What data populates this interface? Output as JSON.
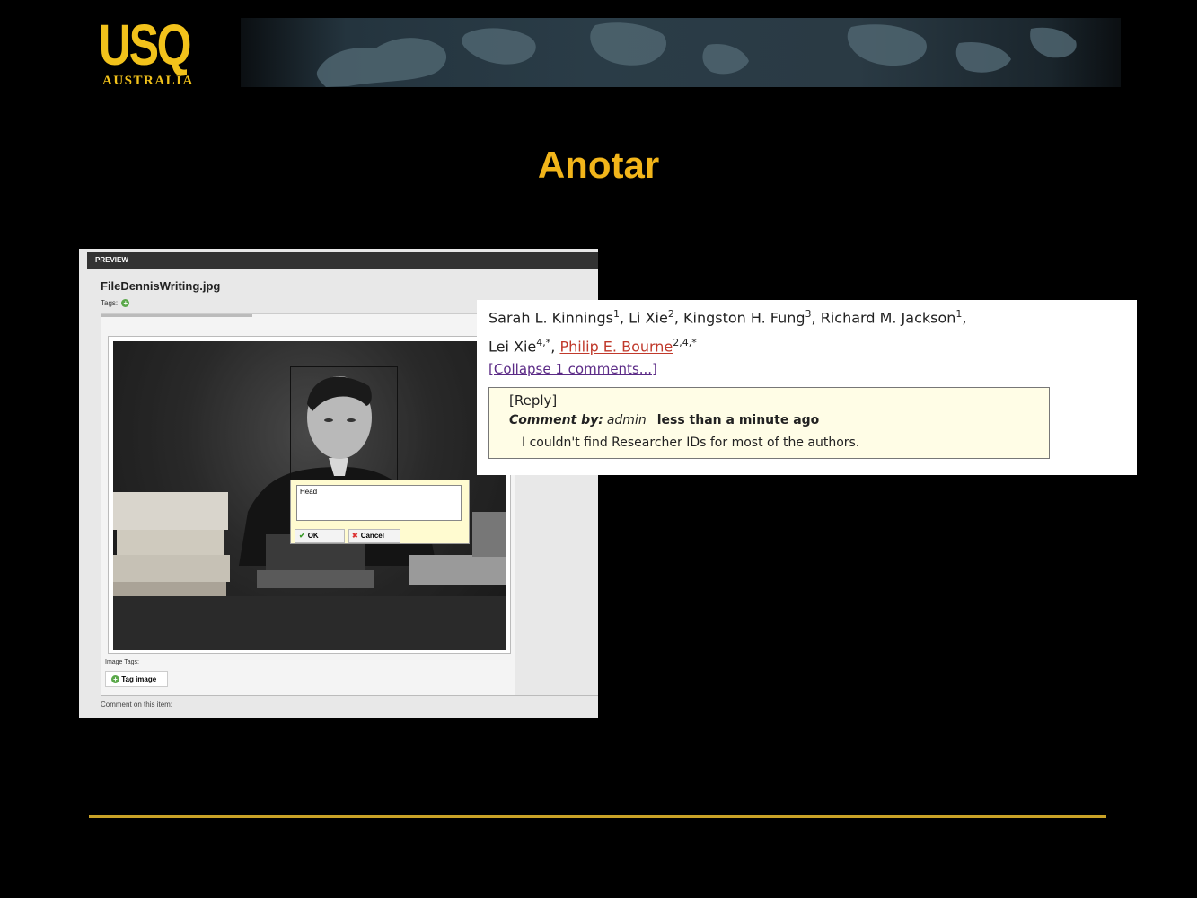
{
  "logo": {
    "main": "USQ",
    "sub": "AUSTRALIA"
  },
  "slide": {
    "title": "Anotar"
  },
  "preview": {
    "header": "PREVIEW",
    "filename": "FileDennisWriting.jpg",
    "tags_label": "Tags:",
    "tag_input_value": "Head",
    "ok_label": "OK",
    "cancel_label": "Cancel",
    "image_tags_label": "Image Tags:",
    "tag_image_label": "Tag image",
    "comment_label": "Comment on this item:"
  },
  "paper": {
    "authors": [
      {
        "name": "Sarah L. Kinnings",
        "sup": "1"
      },
      {
        "name": "Li Xie",
        "sup": "2"
      },
      {
        "name": "Kingston H. Fung",
        "sup": "3"
      },
      {
        "name": "Richard M. Jackson",
        "sup": "1"
      },
      {
        "name": "Lei Xie",
        "sup": "4,*"
      },
      {
        "name": "Philip E. Bourne",
        "sup": "2,4,*"
      }
    ],
    "collapse_link": "[Collapse 1 comments...]",
    "reply_link": "[Reply]",
    "comment_by_label": "Comment by:",
    "comment_author": "admin",
    "comment_time": "less than a minute ago",
    "comment_text": "I couldn't find Researcher IDs for most of the authors."
  },
  "colors": {
    "accent": "#f2b51a",
    "background": "#000000",
    "rule": "#c9a227"
  }
}
